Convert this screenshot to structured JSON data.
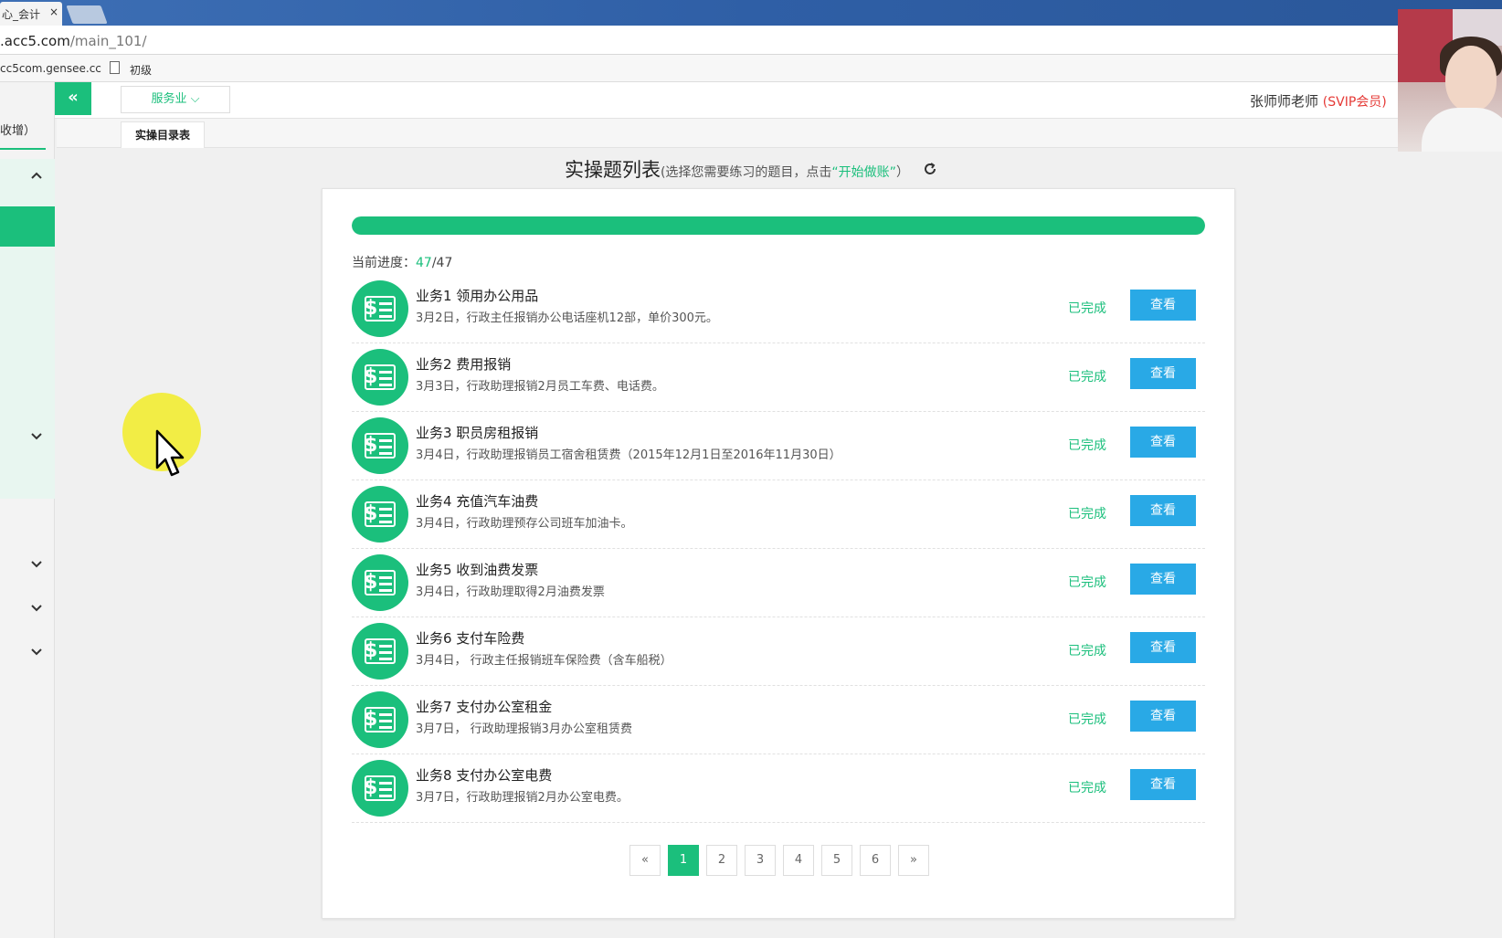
{
  "browser": {
    "tab_title": "心_会计",
    "tab_close": "×",
    "url_host": ".acc5.com",
    "url_path": "/main_101/",
    "bookmark_1": "cc5com.gensee.cc",
    "bookmark_2": "初级"
  },
  "header": {
    "collapse_icon": "«",
    "industry_select": "服务业",
    "user_name": "张师师老师",
    "user_badge": "(SVIP会员)"
  },
  "page_tab": "实操目录表",
  "sidebar": {
    "label": "收增）",
    "chevrons": [
      "up",
      "down",
      "down",
      "down",
      "down"
    ]
  },
  "main": {
    "title": "实操题列表",
    "hint_prefix": "(选择您需要练习的题目，点击",
    "hint_highlight": "“开始做账”",
    "hint_suffix": "）",
    "refresh_icon": "refresh-icon"
  },
  "progress": {
    "label": "当前进度：",
    "current": "47",
    "total": "/47",
    "fraction": 1.0
  },
  "tasks": [
    {
      "title": "业务1 领用办公用品",
      "desc": "3月2日，行政主任报销办公电话座机12部，单价300元。",
      "status": "已完成",
      "button": "查看"
    },
    {
      "title": "业务2 费用报销",
      "desc": "3月3日，行政助理报销2月员工车费、电话费。",
      "status": "已完成",
      "button": "查看"
    },
    {
      "title": "业务3 职员房租报销",
      "desc": "3月4日，行政助理报销员工宿舍租赁费（2015年12月1日至2016年11月30日）",
      "status": "已完成",
      "button": "查看"
    },
    {
      "title": "业务4 充值汽车油费",
      "desc": "3月4日，行政助理预存公司班车加油卡。",
      "status": "已完成",
      "button": "查看"
    },
    {
      "title": "业务5 收到油费发票",
      "desc": "3月4日，行政助理取得2月油费发票",
      "status": "已完成",
      "button": "查看"
    },
    {
      "title": "业务6 支付车险费",
      "desc": "3月4日， 行政主任报销班车保险费（含车船税）",
      "status": "已完成",
      "button": "查看"
    },
    {
      "title": "业务7 支付办公室租金",
      "desc": "3月7日， 行政助理报销3月办公室租赁费",
      "status": "已完成",
      "button": "查看"
    },
    {
      "title": "业务8 支付办公室电费",
      "desc": "3月7日，行政助理报销2月办公室电费。",
      "status": "已完成",
      "button": "查看"
    }
  ],
  "pagination": {
    "prev": "«",
    "pages": [
      "1",
      "2",
      "3",
      "4",
      "5",
      "6"
    ],
    "active": "1",
    "next": "»"
  },
  "colors": {
    "accent": "#1bbf7c",
    "button": "#29a9e6",
    "badge": "#e53935"
  }
}
